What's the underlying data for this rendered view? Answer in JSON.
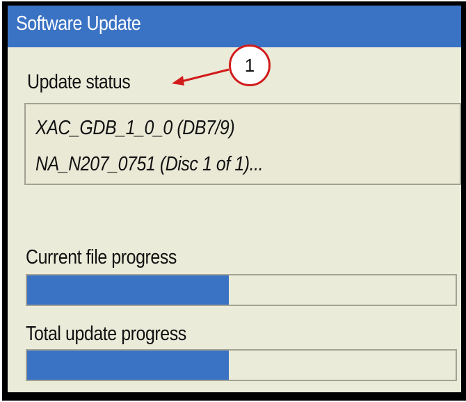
{
  "window": {
    "title": "Software Update"
  },
  "status": {
    "label": "Update status",
    "lines": [
      "XAC_GDB_1_0_0 (DB7/9)",
      "NA_N207_0751 (Disc 1 of 1)..."
    ]
  },
  "current_file": {
    "label": "Current file progress",
    "progress_fraction": 0.47
  },
  "total_update": {
    "label": "Total update progress",
    "progress_fraction": 0.47
  },
  "callout": {
    "number": "1",
    "color": "#d11c1c"
  },
  "colors": {
    "accent": "#3a72c4",
    "background": "#ebebd9"
  }
}
